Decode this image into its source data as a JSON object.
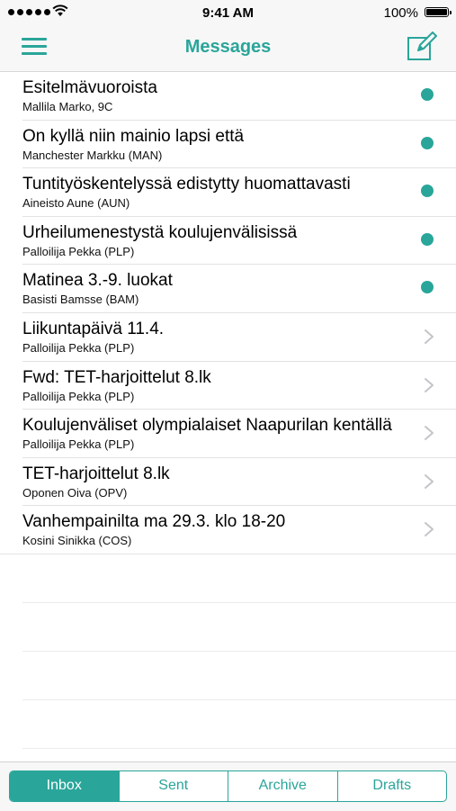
{
  "status_bar": {
    "time": "9:41 AM",
    "battery": "100%"
  },
  "header": {
    "title": "Messages",
    "menu_icon": "hamburger-menu-icon",
    "compose_icon": "compose-icon"
  },
  "colors": {
    "accent": "#2aa59a"
  },
  "messages": [
    {
      "subject": "Esitelmävuoroista",
      "sender": "Mallila Marko, 9C",
      "unread": true
    },
    {
      "subject": "On kyllä niin mainio lapsi että",
      "sender": "Manchester Markku (MAN)",
      "unread": true
    },
    {
      "subject": "Tuntityöskentelyssä edistytty huomattavasti",
      "sender": "Aineisto Aune (AUN)",
      "unread": true
    },
    {
      "subject": "Urheilumenestystä koulujenvälisissä",
      "sender": "Palloilija Pekka (PLP)",
      "unread": true
    },
    {
      "subject": "Matinea 3.-9. luokat",
      "sender": "Basisti Bamsse (BAM)",
      "unread": true
    },
    {
      "subject": "Liikuntapäivä 11.4.",
      "sender": "Palloilija Pekka (PLP)",
      "unread": false
    },
    {
      "subject": "Fwd: TET-harjoittelut 8.lk",
      "sender": "Palloilija Pekka (PLP)",
      "unread": false
    },
    {
      "subject": "Koulujenväliset olympialaiset Naapurilan kentällä",
      "sender": "Palloilija Pekka (PLP)",
      "unread": false
    },
    {
      "subject": "TET-harjoittelut 8.lk",
      "sender": "Oponen Oiva (OPV)",
      "unread": false
    },
    {
      "subject": "Vanhempainilta ma 29.3. klo 18-20",
      "sender": "Kosini Sinikka (COS)",
      "unread": false
    }
  ],
  "tabs": [
    {
      "label": "Inbox",
      "active": true
    },
    {
      "label": "Sent",
      "active": false
    },
    {
      "label": "Archive",
      "active": false
    },
    {
      "label": "Drafts",
      "active": false
    }
  ]
}
